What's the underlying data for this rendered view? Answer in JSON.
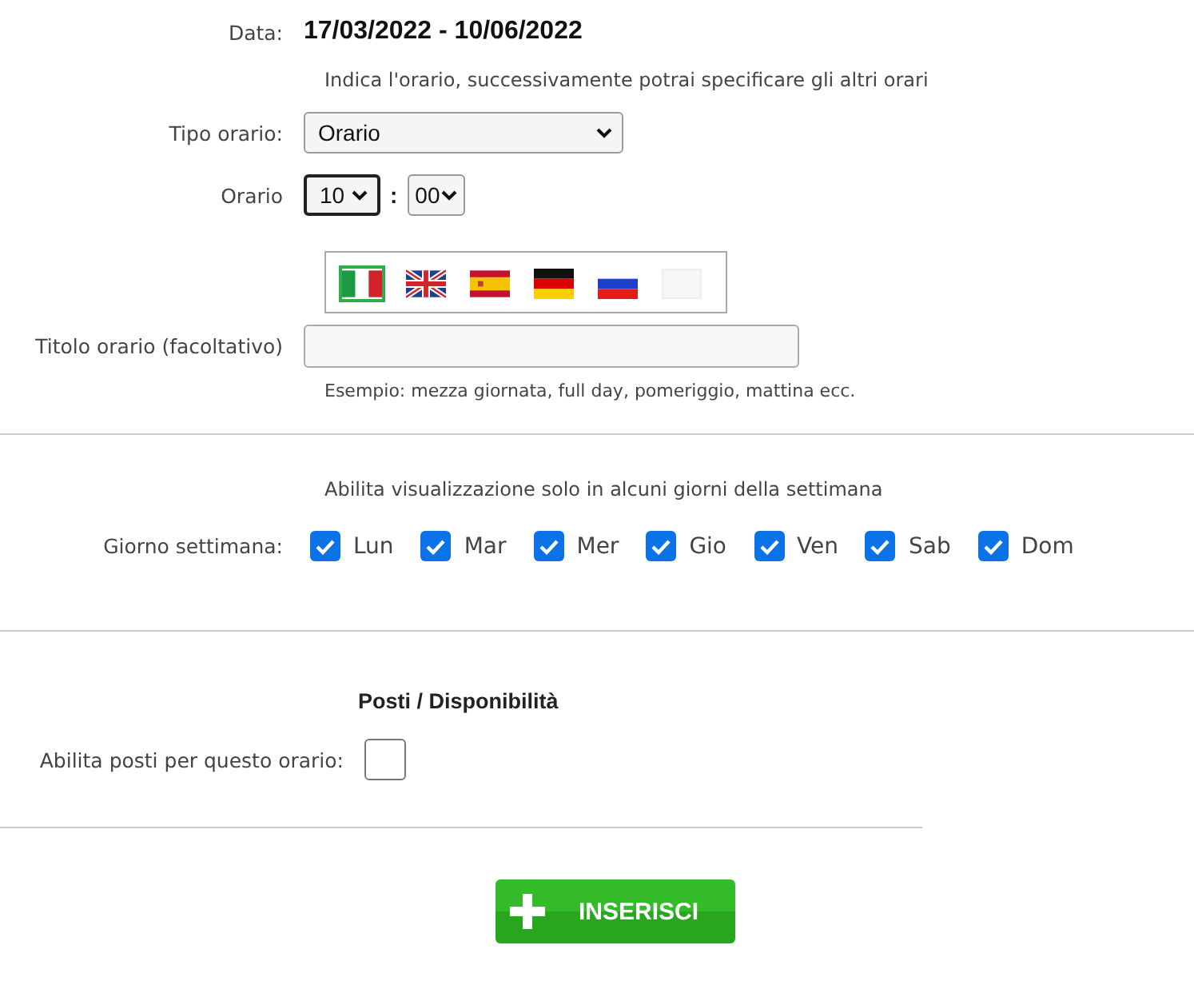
{
  "date_label": "Data:",
  "date_value": "17/03/2022 - 10/06/2022",
  "hint": "Indica l'orario, successivamente potrai specificare gli altri orari",
  "type_field": {
    "label": "Tipo orario:",
    "value": "Orario"
  },
  "time_field": {
    "label": "Orario",
    "hour": "10",
    "hour_focused": true,
    "separator": ":",
    "minute": "00"
  },
  "flags": [
    {
      "kind": "it",
      "selected": true
    },
    {
      "kind": "gb",
      "selected": false
    },
    {
      "kind": "es",
      "selected": false
    },
    {
      "kind": "de",
      "selected": false
    },
    {
      "kind": "ru",
      "selected": false
    },
    {
      "kind": "blank",
      "selected": false
    }
  ],
  "title_field": {
    "label": "Titolo orario (facoltativo)",
    "example": "Esempio: mezza giornata, full day, pomeriggio, mattina ecc."
  },
  "weekdays": {
    "hint": "Abilita visualizzazione solo in alcuni giorni della settimana",
    "label": "Giorno settimana:",
    "days": [
      {
        "label": "Lun",
        "checked": true
      },
      {
        "label": "Mar",
        "checked": true
      },
      {
        "label": "Mer",
        "checked": true
      },
      {
        "label": "Gio",
        "checked": true
      },
      {
        "label": "Ven",
        "checked": true
      },
      {
        "label": "Sab",
        "checked": true
      },
      {
        "label": "Dom",
        "checked": true
      }
    ]
  },
  "seats": {
    "heading": "Posti / Disponibilità",
    "label": "Abilita posti per questo orario:",
    "checked": false
  },
  "submit_button": "INSERISCI"
}
